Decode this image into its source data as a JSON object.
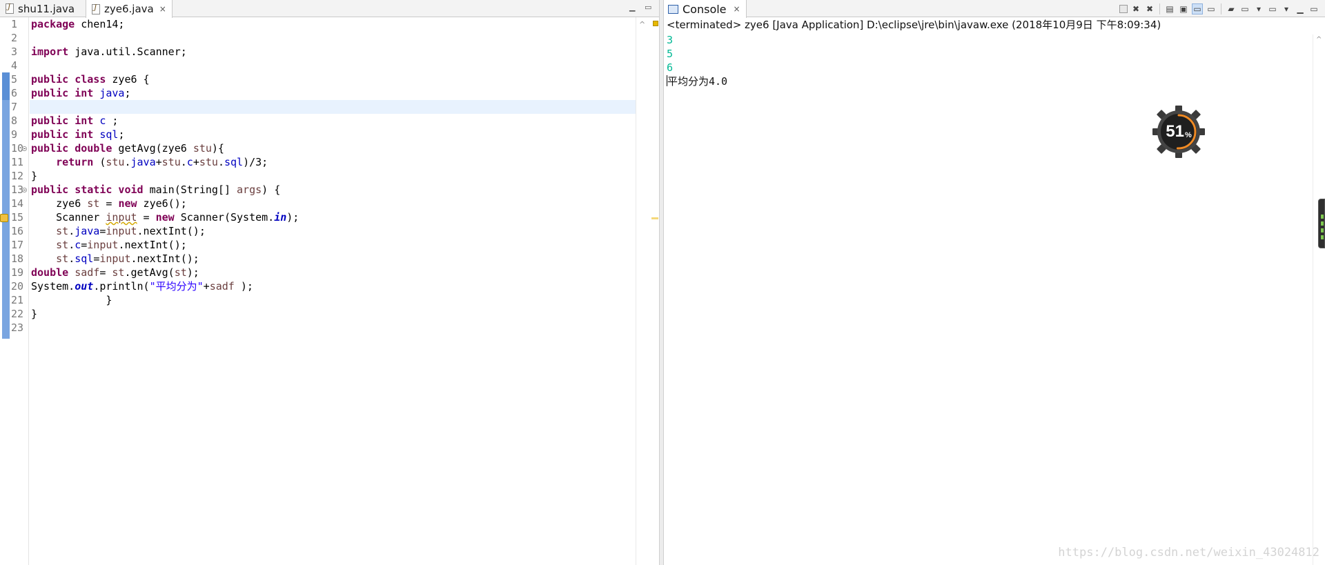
{
  "editor": {
    "tabs": [
      {
        "label": "shu11.java",
        "active": false
      },
      {
        "label": "zye6.java",
        "active": true,
        "close": "×"
      }
    ],
    "lines": [
      {
        "n": "1"
      },
      {
        "n": "2"
      },
      {
        "n": "3"
      },
      {
        "n": "4"
      },
      {
        "n": "5"
      },
      {
        "n": "6"
      },
      {
        "n": "7"
      },
      {
        "n": "8"
      },
      {
        "n": "9"
      },
      {
        "n": "10"
      },
      {
        "n": "11"
      },
      {
        "n": "12"
      },
      {
        "n": "13"
      },
      {
        "n": "14"
      },
      {
        "n": "15"
      },
      {
        "n": "16"
      },
      {
        "n": "17"
      },
      {
        "n": "18"
      },
      {
        "n": "19"
      },
      {
        "n": "20"
      },
      {
        "n": "21"
      },
      {
        "n": "22"
      },
      {
        "n": "23"
      }
    ],
    "code": {
      "l1": {
        "kw": "package",
        "rest": " chen14;"
      },
      "l3": {
        "kw": "import",
        "rest": " java.util.Scanner;"
      },
      "l5": {
        "kw": "public class",
        "rest": " zye6 {"
      },
      "l6": {
        "kw": "public int",
        "field": "java",
        "rest": ";"
      },
      "l8": {
        "kw": "public int",
        "field": "c",
        "rest": " ;"
      },
      "l9": {
        "kw": "public int",
        "field": "sql",
        "rest": ";"
      },
      "l10": {
        "kw": "public double",
        "a": " getAvg(zye6 ",
        "param": "stu",
        "b": "){"
      },
      "l11": {
        "indent": "    ",
        "kw": "return",
        "a": " (",
        "p1": "stu",
        "d1": ".",
        "f1": "java",
        "s1": "+",
        "p2": "stu",
        "d2": ".",
        "f2": "c",
        "s2": "+",
        "p3": "stu",
        "d3": ".",
        "f3": "sql",
        "b": ")/3;"
      },
      "l12": {
        "text": "}"
      },
      "l13": {
        "kw": "public static void",
        "a": " main(String[] ",
        "param": "args",
        "b": ") {"
      },
      "l14": {
        "indent": "    ",
        "a": "zye6 ",
        "v": "st",
        "b": " = ",
        "kw": "new",
        "c": " zye6();"
      },
      "l15": {
        "indent": "    ",
        "a": "Scanner ",
        "v": "input",
        "b": " = ",
        "kw": "new",
        "c": " Scanner(System.",
        "st": "in",
        "d": ");"
      },
      "l16": {
        "indent": "    ",
        "v": "st",
        "d1": ".",
        "f": "java",
        "e": "=",
        "v2": "input",
        "rest": ".nextInt();"
      },
      "l17": {
        "indent": "    ",
        "v": "st",
        "d1": ".",
        "f": "c",
        "e": "=",
        "v2": "input",
        "rest": ".nextInt();"
      },
      "l18": {
        "indent": "    ",
        "v": "st",
        "d1": ".",
        "f": "sql",
        "e": "=",
        "v2": "input",
        "rest": ".nextInt();"
      },
      "l19": {
        "kw": "double",
        "sp": " ",
        "v": "sadf",
        "a": "= ",
        "v2": "st",
        "b": ".getAvg(",
        "v3": "st",
        "c": ");"
      },
      "l20": {
        "a": "System.",
        "st": "out",
        "b": ".println(",
        "str": "\"平均分为\"",
        "c": "+",
        "v": "sadf",
        "d": " );"
      },
      "l21": {
        "text": "            }"
      },
      "l22": {
        "text": "}"
      }
    }
  },
  "console": {
    "tab_label": "Console",
    "tab_close": "×",
    "header": "<terminated> zye6 [Java Application] D:\\eclipse\\jre\\bin\\javaw.exe (2018年10月9日 下午8:09:34)",
    "inputs": [
      "3",
      "5",
      "6"
    ],
    "output": "平均分为4.0"
  },
  "gauge": {
    "value": "51",
    "unit": "%",
    "percent": 51,
    "accent": "#f08a24"
  },
  "watermark": "https://blog.csdn.net/weixin_43024812",
  "colors": {
    "keyword": "#7f0055",
    "field": "#0000c0",
    "string": "#2a00ff",
    "console_input": "#00b894",
    "gutter_mark": "#5a8fd6"
  }
}
